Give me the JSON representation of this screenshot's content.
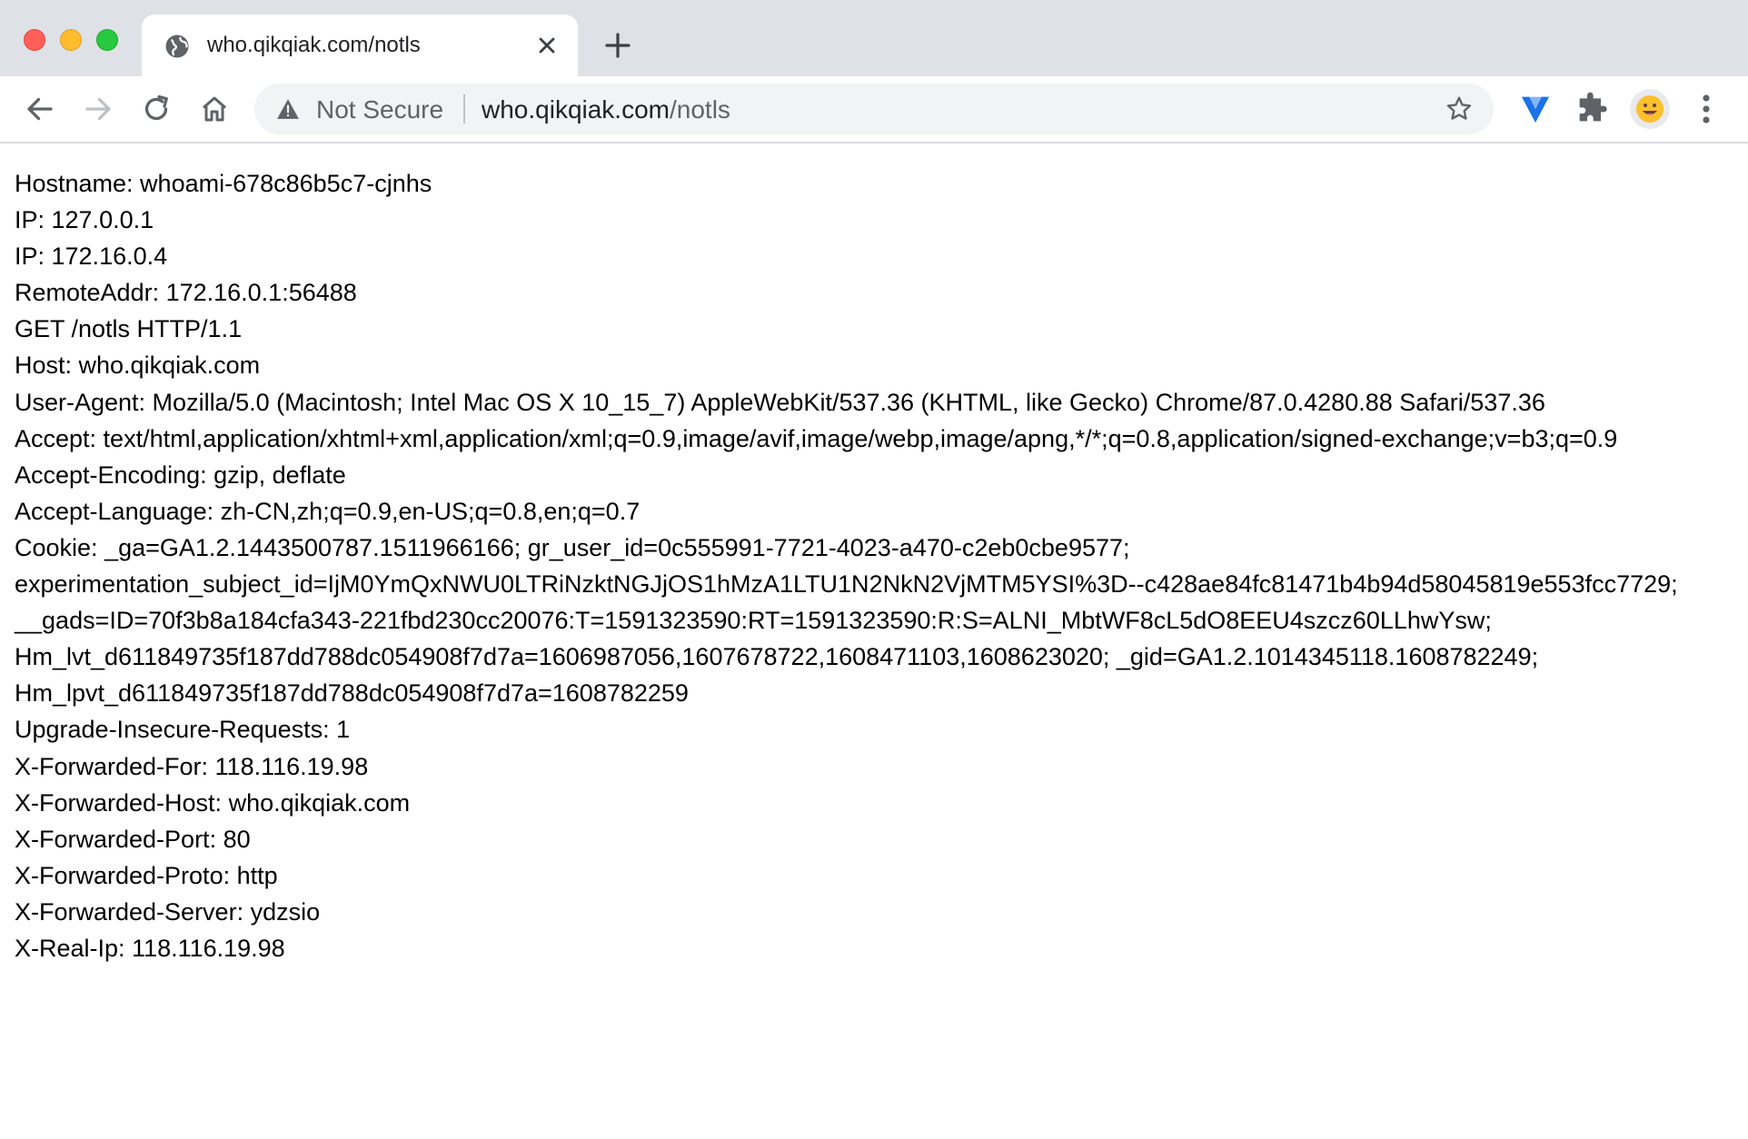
{
  "tab": {
    "title": "who.qikqiak.com/notls",
    "icon": "globe-icon"
  },
  "address_bar": {
    "security_label": "Not Secure",
    "url_host": "who.qikqiak.com",
    "url_path": "/notls"
  },
  "colors": {
    "titlebar": "#dee1e6",
    "omnibox": "#f1f3f4",
    "close_red": "#ff5f57",
    "minimize_yellow": "#febc2e",
    "zoom_green": "#28c840"
  },
  "lines": [
    "Hostname: whoami-678c86b5c7-cjnhs",
    "IP: 127.0.0.1",
    "IP: 172.16.0.4",
    "RemoteAddr: 172.16.0.1:56488",
    "GET /notls HTTP/1.1",
    "Host: who.qikqiak.com",
    "User-Agent: Mozilla/5.0 (Macintosh; Intel Mac OS X 10_15_7) AppleWebKit/537.36 (KHTML, like Gecko) Chrome/87.0.4280.88 Safari/537.36",
    "Accept: text/html,application/xhtml+xml,application/xml;q=0.9,image/avif,image/webp,image/apng,*/*;q=0.8,application/signed-exchange;v=b3;q=0.9",
    "Accept-Encoding: gzip, deflate",
    "Accept-Language: zh-CN,zh;q=0.9,en-US;q=0.8,en;q=0.7",
    "Cookie: _ga=GA1.2.1443500787.1511966166; gr_user_id=0c555991-7721-4023-a470-c2eb0cbe9577;",
    "experimentation_subject_id=IjM0YmQxNWU0LTRiNzktNGJjOS1hMzA1LTU1N2NkN2VjMTM5YSI%3D--c428ae84fc81471b4b94d58045819e553fcc7729;",
    "__gads=ID=70f3b8a184cfa343-221fbd230cc20076:T=1591323590:RT=1591323590:R:S=ALNI_MbtWF8cL5dO8EEU4szcz60LLhwYsw;",
    "Hm_lvt_d611849735f187dd788dc054908f7d7a=1606987056,1607678722,1608471103,1608623020; _gid=GA1.2.1014345118.1608782249;",
    "Hm_lpvt_d611849735f187dd788dc054908f7d7a=1608782259",
    "Upgrade-Insecure-Requests: 1",
    "X-Forwarded-For: 118.116.19.98",
    "X-Forwarded-Host: who.qikqiak.com",
    "X-Forwarded-Port: 80",
    "X-Forwarded-Proto: http",
    "X-Forwarded-Server: ydzsio",
    "X-Real-Ip: 118.116.19.98"
  ]
}
